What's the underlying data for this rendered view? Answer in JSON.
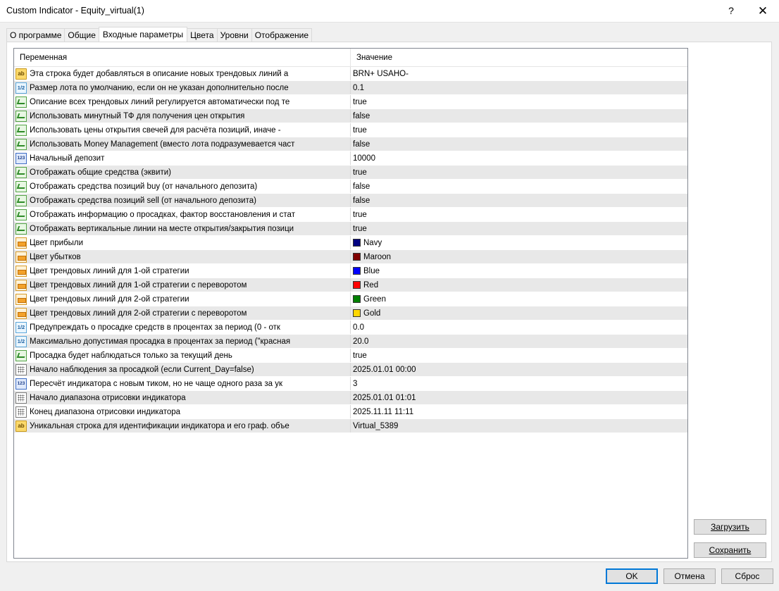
{
  "window": {
    "title": "Custom Indicator - Equity_virtual(1)",
    "help": "?",
    "close": "✕"
  },
  "tabs": [
    {
      "label": "О программе",
      "active": false
    },
    {
      "label": "Общие",
      "active": false
    },
    {
      "label": "Входные параметры",
      "active": true
    },
    {
      "label": "Цвета",
      "active": false
    },
    {
      "label": "Уровни",
      "active": false
    },
    {
      "label": "Отображение",
      "active": false
    }
  ],
  "grid": {
    "columns": {
      "variable": "Переменная",
      "value": "Значение"
    },
    "rows": [
      {
        "icon": "str",
        "name": "Эта строка будет добавляться в описание новых трендовых линий а",
        "value": "BRN+ USAHO-"
      },
      {
        "icon": "dbl",
        "name": "Размер лота по умолчанию, если он не указан дополнительно после",
        "value": "0.1"
      },
      {
        "icon": "bool",
        "name": "Описание всех трендовых линий регулируется автоматически под те",
        "value": "true"
      },
      {
        "icon": "bool",
        "name": "Использовать минутный ТФ для получения цен открытия",
        "value": "false"
      },
      {
        "icon": "bool",
        "name": "Использовать цены открытия свечей для расчёта позиций, иначе -",
        "value": "true"
      },
      {
        "icon": "bool",
        "name": "Использовать Money Management (вместо лота подразумевается част",
        "value": "false"
      },
      {
        "icon": "int",
        "name": "Начальный депозит",
        "value": "10000"
      },
      {
        "icon": "bool",
        "name": "Отображать общие средства (эквити)",
        "value": "true"
      },
      {
        "icon": "bool",
        "name": "Отображать средства позиций buy (от начального депозита)",
        "value": "false"
      },
      {
        "icon": "bool",
        "name": "Отображать средства позиций sell (от начального депозита)",
        "value": "false"
      },
      {
        "icon": "bool",
        "name": "Отображать информацию о просадках, фактор восстановления и стат",
        "value": "true"
      },
      {
        "icon": "bool",
        "name": "Отображать вертикальные линии на месте открытия/закрытия позици",
        "value": "true"
      },
      {
        "icon": "color",
        "name": "Цвет прибыли",
        "value": "Navy",
        "swatch": "#000080"
      },
      {
        "icon": "color",
        "name": "Цвет убытков",
        "value": "Maroon",
        "swatch": "#800000"
      },
      {
        "icon": "color",
        "name": "Цвет трендовых линий для 1-ой стратегии",
        "value": "Blue",
        "swatch": "#0000ff"
      },
      {
        "icon": "color",
        "name": "Цвет трендовых линий для 1-ой стратегии с переворотом",
        "value": "Red",
        "swatch": "#ff0000"
      },
      {
        "icon": "color",
        "name": "Цвет трендовых линий для 2-ой стратегии",
        "value": "Green",
        "swatch": "#008000"
      },
      {
        "icon": "color",
        "name": "Цвет трендовых линий для 2-ой стратегии с переворотом",
        "value": "Gold",
        "swatch": "#ffd700"
      },
      {
        "icon": "dbl",
        "name": "Предупреждать о просадке средств в процентах за период (0 - отк",
        "value": "0.0"
      },
      {
        "icon": "dbl",
        "name": "Максимально допустимая просадка в процентах за период (\"красная",
        "value": "20.0"
      },
      {
        "icon": "bool",
        "name": "Просадка будет наблюдаться только за текущий день",
        "value": "true"
      },
      {
        "icon": "dt",
        "name": "Начало наблюдения за просадкой (если Current_Day=false)",
        "value": "2025.01.01 00:00"
      },
      {
        "icon": "int",
        "name": "Пересчёт индикатора с новым тиком, но не чаще одного раза за ук",
        "value": "3"
      },
      {
        "icon": "dt",
        "name": "Начало диапазона отрисовки индикатора",
        "value": "2025.01.01 01:01"
      },
      {
        "icon": "dt",
        "name": "Конец диапазона отрисовки индикатора",
        "value": "2025.11.11 11:11"
      },
      {
        "icon": "str",
        "name": "Уникальная строка для идентификации индикатора и его граф. объе",
        "value": "Virtual_5389"
      }
    ]
  },
  "icon_glyphs": {
    "str": "ab",
    "dbl": "1/2",
    "int": "123"
  },
  "buttons": {
    "load": "Загрузить",
    "save": "Сохранить",
    "ok": "OK",
    "cancel": "Отмена",
    "reset": "Сброс"
  }
}
